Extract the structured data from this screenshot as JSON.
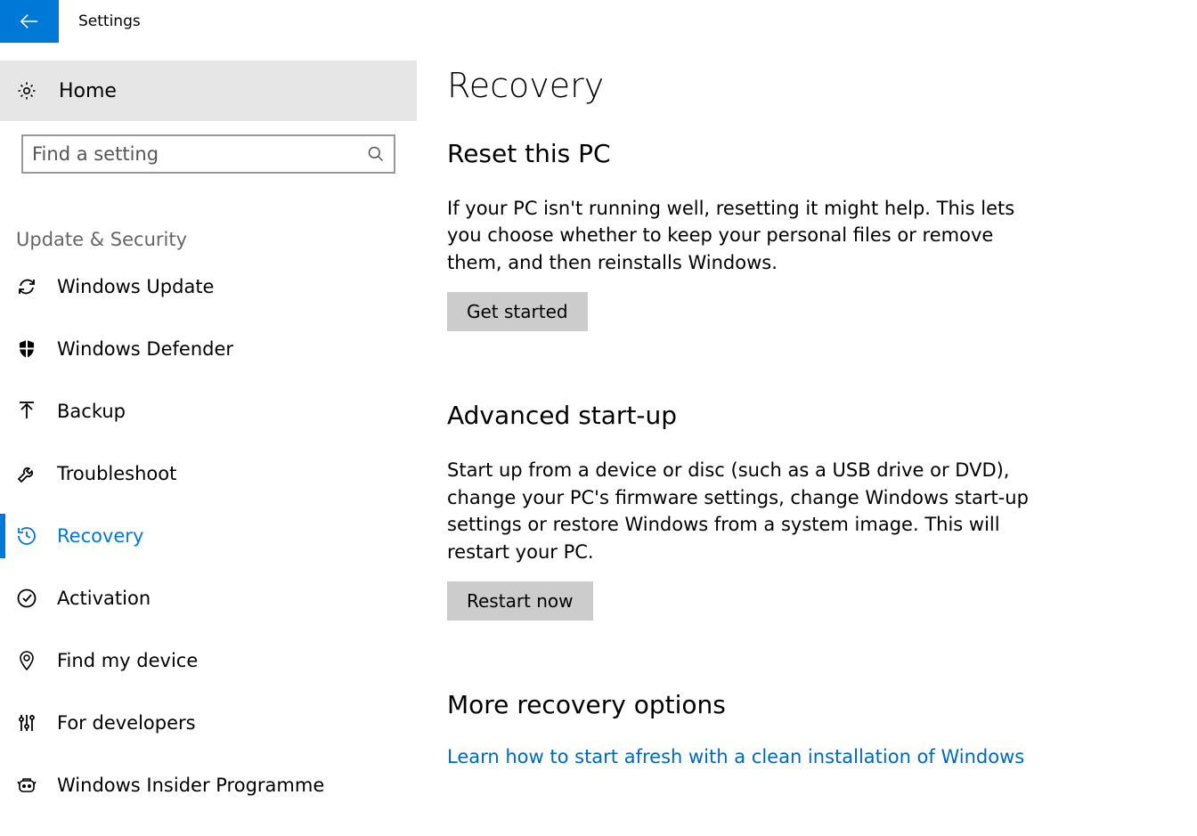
{
  "header": {
    "title": "Settings"
  },
  "sidebar": {
    "home_label": "Home",
    "search_placeholder": "Find a setting",
    "section_title": "Update & Security",
    "items": [
      {
        "label": "Windows Update",
        "active": false
      },
      {
        "label": "Windows Defender",
        "active": false
      },
      {
        "label": "Backup",
        "active": false
      },
      {
        "label": "Troubleshoot",
        "active": false
      },
      {
        "label": "Recovery",
        "active": true
      },
      {
        "label": "Activation",
        "active": false
      },
      {
        "label": "Find my device",
        "active": false
      },
      {
        "label": "For developers",
        "active": false
      },
      {
        "label": "Windows Insider Programme",
        "active": false
      }
    ]
  },
  "main": {
    "page_title": "Recovery",
    "reset": {
      "title": "Reset this PC",
      "text": "If your PC isn't running well, resetting it might help. This lets you choose whether to keep your personal files or remove them, and then reinstalls Windows.",
      "button": "Get started"
    },
    "advanced": {
      "title": "Advanced start-up",
      "text": "Start up from a device or disc (such as a USB drive or DVD), change your PC's firmware settings, change Windows start-up settings or restore Windows from a system image. This will restart your PC.",
      "button": "Restart now"
    },
    "more": {
      "title": "More recovery options",
      "link": "Learn how to start afresh with a clean installation of Windows"
    }
  }
}
